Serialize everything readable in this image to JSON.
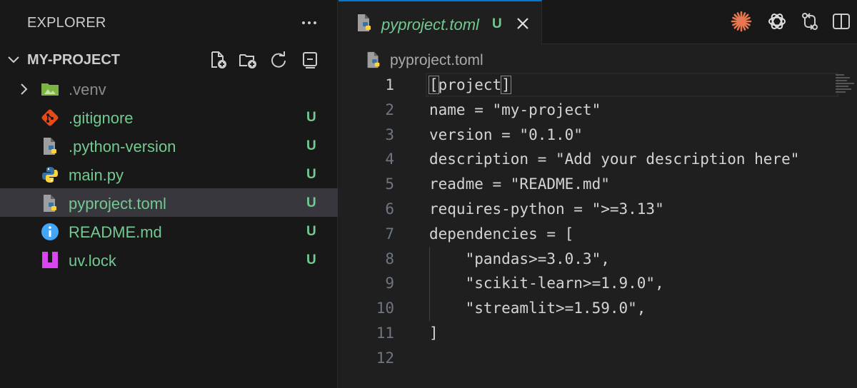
{
  "sidebar": {
    "title": "EXPLORER",
    "project_name": "MY-PROJECT",
    "project_actions": [
      "new-file-icon",
      "new-folder-icon",
      "refresh-icon",
      "collapse-all-icon"
    ],
    "files": [
      {
        "name": ".venv",
        "type": "folder",
        "status": "",
        "icon": "folder-icon"
      },
      {
        "name": ".gitignore",
        "type": "file",
        "status": "U",
        "icon": "git-icon"
      },
      {
        "name": ".python-version",
        "type": "file",
        "status": "U",
        "icon": "python-file-icon"
      },
      {
        "name": "main.py",
        "type": "file",
        "status": "U",
        "icon": "python-icon"
      },
      {
        "name": "pyproject.toml",
        "type": "file",
        "status": "U",
        "icon": "python-file-icon",
        "selected": true
      },
      {
        "name": "README.md",
        "type": "file",
        "status": "U",
        "icon": "info-icon"
      },
      {
        "name": "uv.lock",
        "type": "file",
        "status": "U",
        "icon": "uv-icon"
      }
    ]
  },
  "editor": {
    "tab": {
      "label": "pyproject.toml",
      "status": "U"
    },
    "breadcrumb": "pyproject.toml",
    "actions": [
      "claude-icon",
      "openai-icon",
      "compare-icon",
      "split-editor-icon"
    ],
    "lines": [
      {
        "no": "1",
        "text": "[project]"
      },
      {
        "no": "2",
        "text": "name = \"my-project\""
      },
      {
        "no": "3",
        "text": "version = \"0.1.0\""
      },
      {
        "no": "4",
        "text": "description = \"Add your description here\""
      },
      {
        "no": "5",
        "text": "readme = \"README.md\""
      },
      {
        "no": "6",
        "text": "requires-python = \">=3.13\""
      },
      {
        "no": "7",
        "text": "dependencies = ["
      },
      {
        "no": "8",
        "text": "    \"pandas>=3.0.3\","
      },
      {
        "no": "9",
        "text": "    \"scikit-learn>=1.9.0\","
      },
      {
        "no": "10",
        "text": "    \"streamlit>=1.59.0\","
      },
      {
        "no": "11",
        "text": "]"
      },
      {
        "no": "12",
        "text": ""
      }
    ]
  },
  "colors": {
    "untracked": "#73c991",
    "accent": "#0078d4"
  }
}
